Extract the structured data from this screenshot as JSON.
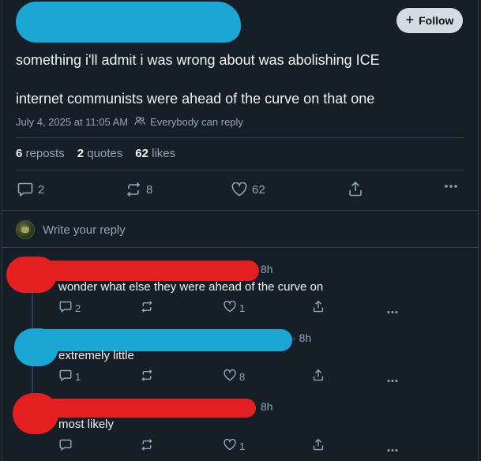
{
  "post": {
    "follow_label": "Follow",
    "line1": "something i'll admit i was wrong about was abolishing ICE",
    "line2": "internet communists were ahead of the curve on that one",
    "timestamp": "July 4, 2025 at 11:05 AM",
    "reply_setting": "Everybody can reply",
    "stats": {
      "reposts_count": "6",
      "reposts_label": "reposts",
      "quotes_count": "2",
      "quotes_label": "quotes",
      "likes_count": "62",
      "likes_label": "likes"
    },
    "actions": {
      "replies": "2",
      "reposts": "8",
      "likes": "62"
    }
  },
  "compose": {
    "placeholder": "Write your reply"
  },
  "replies": [
    {
      "time": "8h",
      "text": "wonder what else they were ahead of the curve on",
      "reply_count": "2",
      "like_count": "1"
    },
    {
      "time": "· 8h",
      "text": "extremely little",
      "reply_count": "1",
      "like_count": "8"
    },
    {
      "time": "8h",
      "text": "most likely",
      "reply_count": "",
      "like_count": "1"
    }
  ],
  "colors": {
    "background": "#161e27",
    "follow_bg": "#d4dbe2",
    "muted": "#93a5b7",
    "redact_blue": "#1aa7d4",
    "redact_red": "#e3201f"
  },
  "icons": [
    "plus-icon",
    "people-icon",
    "comment-icon",
    "repost-icon",
    "heart-icon",
    "share-icon",
    "more-icon"
  ]
}
